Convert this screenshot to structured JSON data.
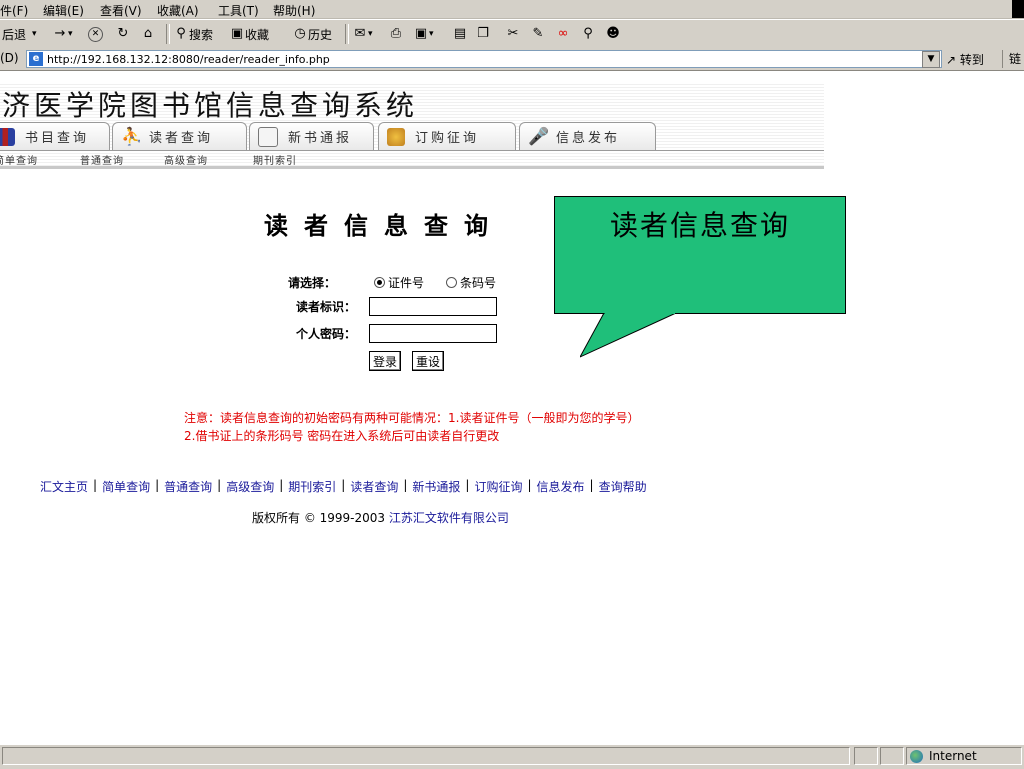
{
  "menu": [
    "件(F)",
    "编辑(E)",
    "查看(V)",
    "收藏(A)",
    "工具(T)",
    "帮助(H)"
  ],
  "toolbar": {
    "back": "后退",
    "back_arrow": "▾",
    "forward": "→",
    "forward_arrow": "▾",
    "stop": "✕",
    "refresh": "↻",
    "home": "⌂",
    "search": "搜索",
    "favorites": "收藏",
    "history": "历史",
    "mail": "✉",
    "mail_arrow": "▾",
    "print": "⎙",
    "edit": "▣",
    "edit_arrow": "▾",
    "discuss": "▤",
    "messenger": "❐",
    "tool1": "✂",
    "tool2": "✎",
    "tool3": "∞",
    "tool4": "⚲",
    "tool5": "☻"
  },
  "address": {
    "label": "(D)",
    "ie_logo": "e",
    "url": "http://192.168.132.12:8080/reader/reader_info.php",
    "dropdown": "▼",
    "go": "转到",
    "links": "链"
  },
  "site": {
    "title": "济医学院图书馆信息查询系统",
    "tabs": [
      "书目查询",
      "读者查询",
      "新书通报",
      "订购征询",
      "信息发布"
    ],
    "subnav": [
      "简单查询",
      "普通查询",
      "高级查询",
      "期刊索引"
    ]
  },
  "form": {
    "heading": "读者信息查询",
    "select_label": "请选择：",
    "option_card": "证件号",
    "option_barcode": "条码号",
    "reader_id_label": "读者标识：",
    "password_label": "个人密码：",
    "login": "登录",
    "reset": "重设"
  },
  "callout": {
    "text": "读者信息查询"
  },
  "notice": {
    "line1": "注意：读者信息查询的初始密码有两种可能情况：1.读者证件号（一般即为您的学号）",
    "line2": "2.借书证上的条形码号 密码在进入系统后可由读者自行更改"
  },
  "footer": {
    "links": [
      "汇文主页",
      "简单查询",
      "普通查询",
      "高级查询",
      "期刊索引",
      "读者查询",
      "新书通报",
      "订购征询",
      "信息发布",
      "查询帮助"
    ],
    "separator": "|",
    "copyright_prefix": "版权所有 © 1999-2003",
    "company": "江苏汇文软件有限公司"
  },
  "status": {
    "zone": "Internet"
  },
  "colors": {
    "callout": "#1fbf7a",
    "notice": "#e00000",
    "link": "#1a1a9a"
  }
}
